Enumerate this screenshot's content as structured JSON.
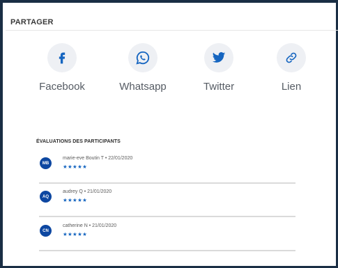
{
  "share": {
    "title": "PARTAGER",
    "items": [
      {
        "label": "Facebook",
        "icon": "facebook-icon"
      },
      {
        "label": "Whatsapp",
        "icon": "whatsapp-icon"
      },
      {
        "label": "Twitter",
        "icon": "twitter-icon"
      },
      {
        "label": "Lien",
        "icon": "link-icon"
      }
    ]
  },
  "ratings": {
    "title": "ÉVALUATIONS DES PARTICIPANTS",
    "items": [
      {
        "initials": "MB",
        "meta": "marie-eve Boutin T • 22/01/2020",
        "stars": "★★★★★",
        "rating": 5
      },
      {
        "initials": "AQ",
        "meta": "audrey Q • 21/01/2020",
        "stars": "★★★★★",
        "rating": 5
      },
      {
        "initials": "CN",
        "meta": "catherine N • 21/01/2020",
        "stars": "★★★★★",
        "rating": 5
      }
    ]
  },
  "colors": {
    "frame": "#1a2e44",
    "icon_blue": "#1565c0",
    "avatar_bg": "#0d47a1",
    "circle_bg": "#eef0f4"
  }
}
